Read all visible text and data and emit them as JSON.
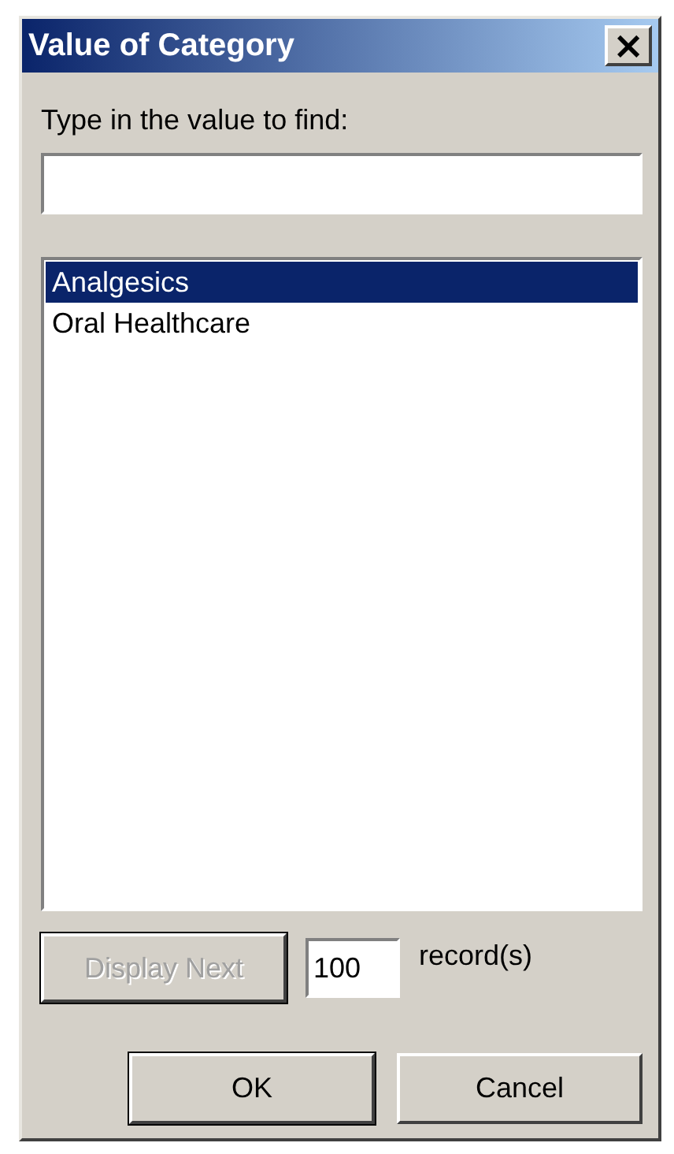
{
  "window": {
    "title": "Value of Category",
    "close": "×"
  },
  "find_label": "Type in the value to find:",
  "list": {
    "items": [
      {
        "label": "Analgesics",
        "selected": true
      },
      {
        "label": "Oral Healthcare",
        "selected": false
      }
    ]
  },
  "display_next": {
    "label": "Display Next",
    "disabled": true
  },
  "count_field": {
    "value": "100"
  },
  "count_unit": "record(s)",
  "buttons": [
    {
      "label": "OK",
      "default": true
    },
    {
      "label": "Cancel",
      "default": false
    }
  ]
}
